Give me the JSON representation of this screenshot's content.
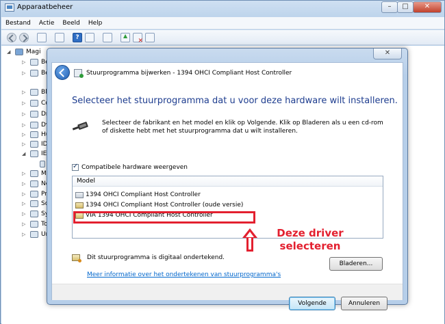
{
  "window": {
    "title": "Apparaatbeheer",
    "minimize": "–",
    "maximize": "□",
    "close": "✕"
  },
  "menu": [
    "Bestand",
    "Actie",
    "Beeld",
    "Help"
  ],
  "toolbar_icons": [
    "back-icon",
    "forward-icon",
    "properties-icon",
    "list-icon",
    "help-icon",
    "details-icon",
    "scan-hardware-icon",
    "update-driver-icon",
    "disable-icon",
    "uninstall-icon"
  ],
  "tree": {
    "root": "Magi",
    "items": [
      "Be",
      "Be",
      "Bl",
      "Co",
      "Dr",
      "Dv",
      "Hu",
      "ID",
      "IE",
      "",
      "M",
      "Ne",
      "Pr",
      "So",
      "Sy",
      "To",
      "Ur"
    ]
  },
  "dialog": {
    "close": "✕",
    "header_title": "Stuurprogramma bijwerken - 1394 OHCI Compliant Host Controller",
    "heading": "Selecteer het stuurprogramma dat u voor deze hardware wilt installeren.",
    "instructions": "Selecteer de fabrikant en het model en klik op Volgende. Klik op Bladeren als u een cd-rom of diskette hebt met het stuurprogramma dat u wilt installeren.",
    "compat_label": "Compatibele hardware weergeven",
    "list_header": "Model",
    "list_items": [
      "1394 OHCI Compliant Host Controller",
      "1394 OHCI Compliant Host Controller (oude versie)",
      "VIA 1394 OHCI Compliant Host Controller"
    ],
    "signed_text": "Dit stuurprogramma is digitaal ondertekend.",
    "browse_button": "Bladeren...",
    "link_text": "Meer informatie over het ondertekenen van stuurprogramma's",
    "next_button": "Volgende",
    "cancel_button": "Annuleren"
  },
  "annotation": {
    "line1": "Deze driver",
    "line2": "selecteren",
    "color": "#e3202f"
  }
}
